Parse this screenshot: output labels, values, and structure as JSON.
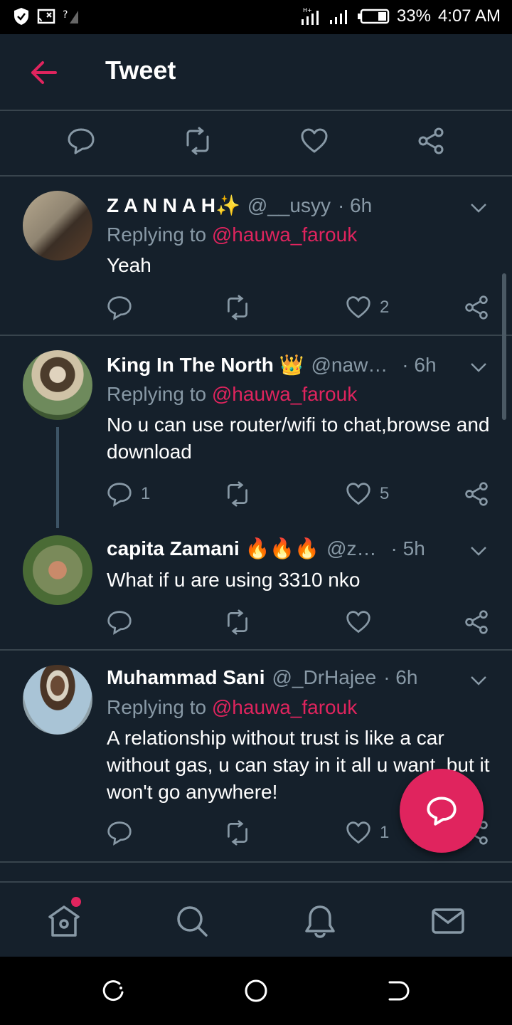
{
  "status_bar": {
    "battery_percent": "33%",
    "time": "4:07 AM",
    "icons": [
      "shield-icon",
      "cast-icon",
      "no-signal-icon",
      "signal-icon",
      "signal-icon",
      "battery-icon"
    ]
  },
  "header": {
    "title": "Tweet",
    "back_icon": "arrow-left-icon"
  },
  "action_bar": {
    "icons": [
      "reply-icon",
      "retweet-icon",
      "like-icon",
      "share-icon"
    ]
  },
  "tweets": [
    {
      "name": "Z A N N A H✨",
      "handle": "@__usyy",
      "time": "· 6h",
      "replying_prefix": "Replying to ",
      "replying_to": "@hauwa_farouk",
      "text": "Yeah",
      "reply_count": "",
      "retweet_count": "",
      "like_count": "2"
    },
    {
      "name": "King In The North 👑",
      "handle": "@naw…",
      "time": "· 6h",
      "replying_prefix": "Replying to ",
      "replying_to": "@hauwa_farouk",
      "text": "No u can use router/wifi to chat,browse and download",
      "reply_count": "1",
      "retweet_count": "",
      "like_count": "5"
    },
    {
      "name": "capita Zamani 🔥🔥🔥",
      "handle": "@z…",
      "time": "· 5h",
      "text": "What if u are using 3310 nko",
      "reply_count": "",
      "retweet_count": "",
      "like_count": ""
    },
    {
      "name": "Muhammad Sani",
      "handle": "@_DrHajee",
      "time": "· 6h",
      "replying_prefix": "Replying to ",
      "replying_to": "@hauwa_farouk",
      "text": "A relationship without trust is like a car without gas, u can stay in it all u want, but it won't go anywhere!",
      "reply_count": "",
      "retweet_count": "",
      "like_count": "1"
    }
  ],
  "fab": {
    "icon": "compose-reply-icon"
  },
  "bottom_nav": {
    "items": [
      "home-icon",
      "search-icon",
      "notifications-icon",
      "messages-icon"
    ]
  },
  "system_nav": {
    "items": [
      "recent-apps-icon",
      "home-button-icon",
      "back-button-icon"
    ]
  },
  "colors": {
    "background": "#15202b",
    "accent": "#e0245e",
    "secondary_text": "#8899a6",
    "divider": "#38444d"
  }
}
